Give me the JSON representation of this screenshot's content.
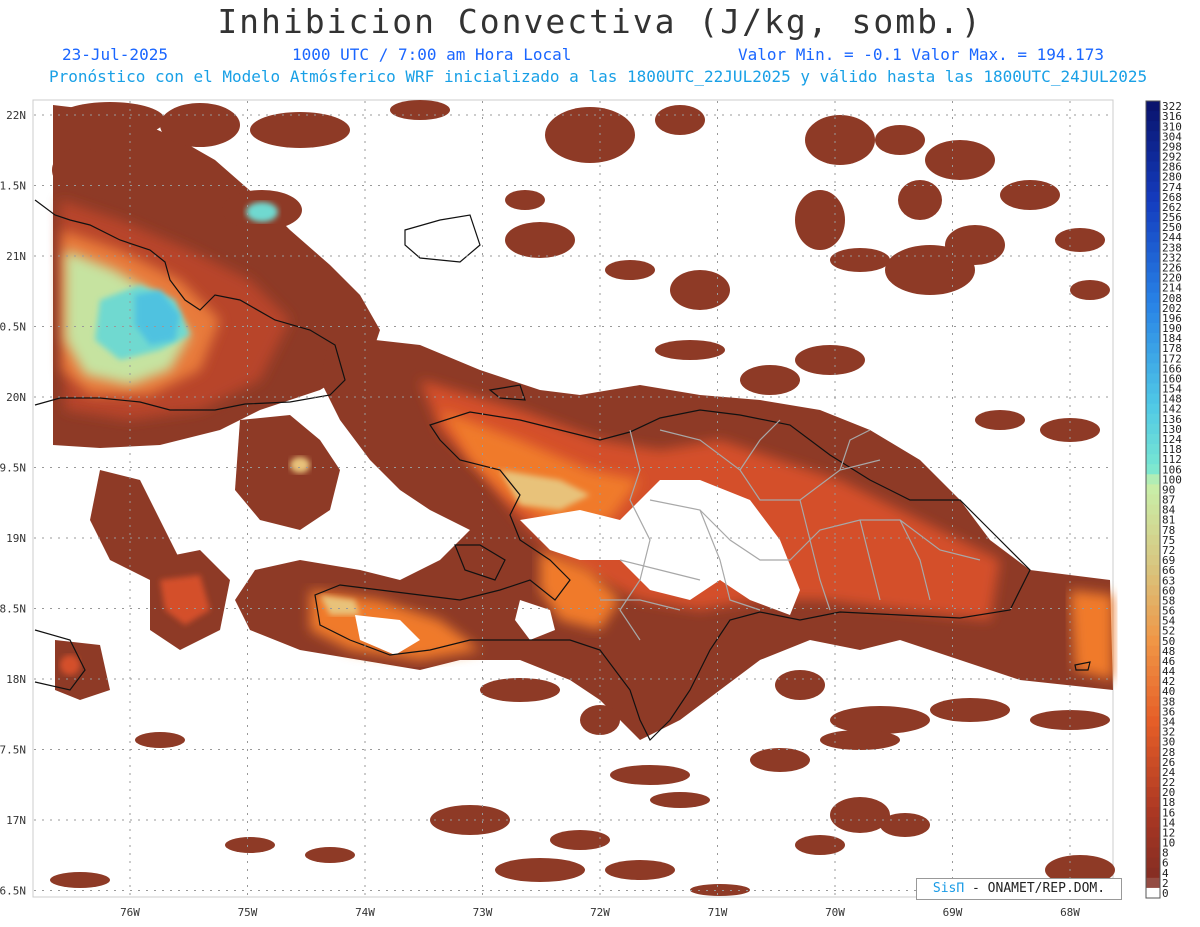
{
  "header": {
    "title": "Inhibicion Convectiva (J/kg, somb.)",
    "date": "23-Jul-2025",
    "time": "1000 UTC / 7:00 am Hora Local",
    "minmax": "Valor Min. = -0.1  Valor Max. = 194.173",
    "model_info": "Pronóstico con el Modelo Atmósferico WRF inicializado a las 1800UTC_22JUL2025 y válido hasta las  1800UTC_24JUL2025"
  },
  "axes": {
    "lat_labels": [
      "22N",
      "1.5N",
      "21N",
      "0.5N",
      "20N",
      "9.5N",
      "19N",
      "8.5N",
      "18N",
      "7.5N",
      "17N",
      "6.5N"
    ],
    "lon_labels": [
      "76W",
      "75W",
      "74W",
      "73W",
      "72W",
      "71W",
      "70W",
      "69W",
      "68W"
    ]
  },
  "colorbar": {
    "ticks": [
      "322",
      "316",
      "310",
      "304",
      "298",
      "292",
      "286",
      "280",
      "274",
      "268",
      "262",
      "256",
      "250",
      "244",
      "238",
      "232",
      "226",
      "220",
      "214",
      "208",
      "202",
      "196",
      "190",
      "184",
      "178",
      "172",
      "166",
      "160",
      "154",
      "148",
      "142",
      "136",
      "130",
      "124",
      "118",
      "112",
      "106",
      "100",
      "90",
      "87",
      "84",
      "81",
      "78",
      "75",
      "72",
      "69",
      "66",
      "63",
      "60",
      "58",
      "56",
      "54",
      "52",
      "50",
      "48",
      "46",
      "44",
      "42",
      "40",
      "38",
      "36",
      "34",
      "32",
      "30",
      "28",
      "26",
      "24",
      "22",
      "20",
      "18",
      "16",
      "14",
      "12",
      "10",
      "8",
      "6",
      "4",
      "2",
      "0"
    ]
  },
  "credit": {
    "brand": "SisΠ",
    "text": " - ONAMET/REP.DOM."
  },
  "colors": {
    "base": "#8e3a26",
    "mid": "#d4502a",
    "warm": "#f07a2a",
    "light": "#c8e89a",
    "cyan": "#6fe0d6",
    "blue": "#3aa8e8"
  }
}
